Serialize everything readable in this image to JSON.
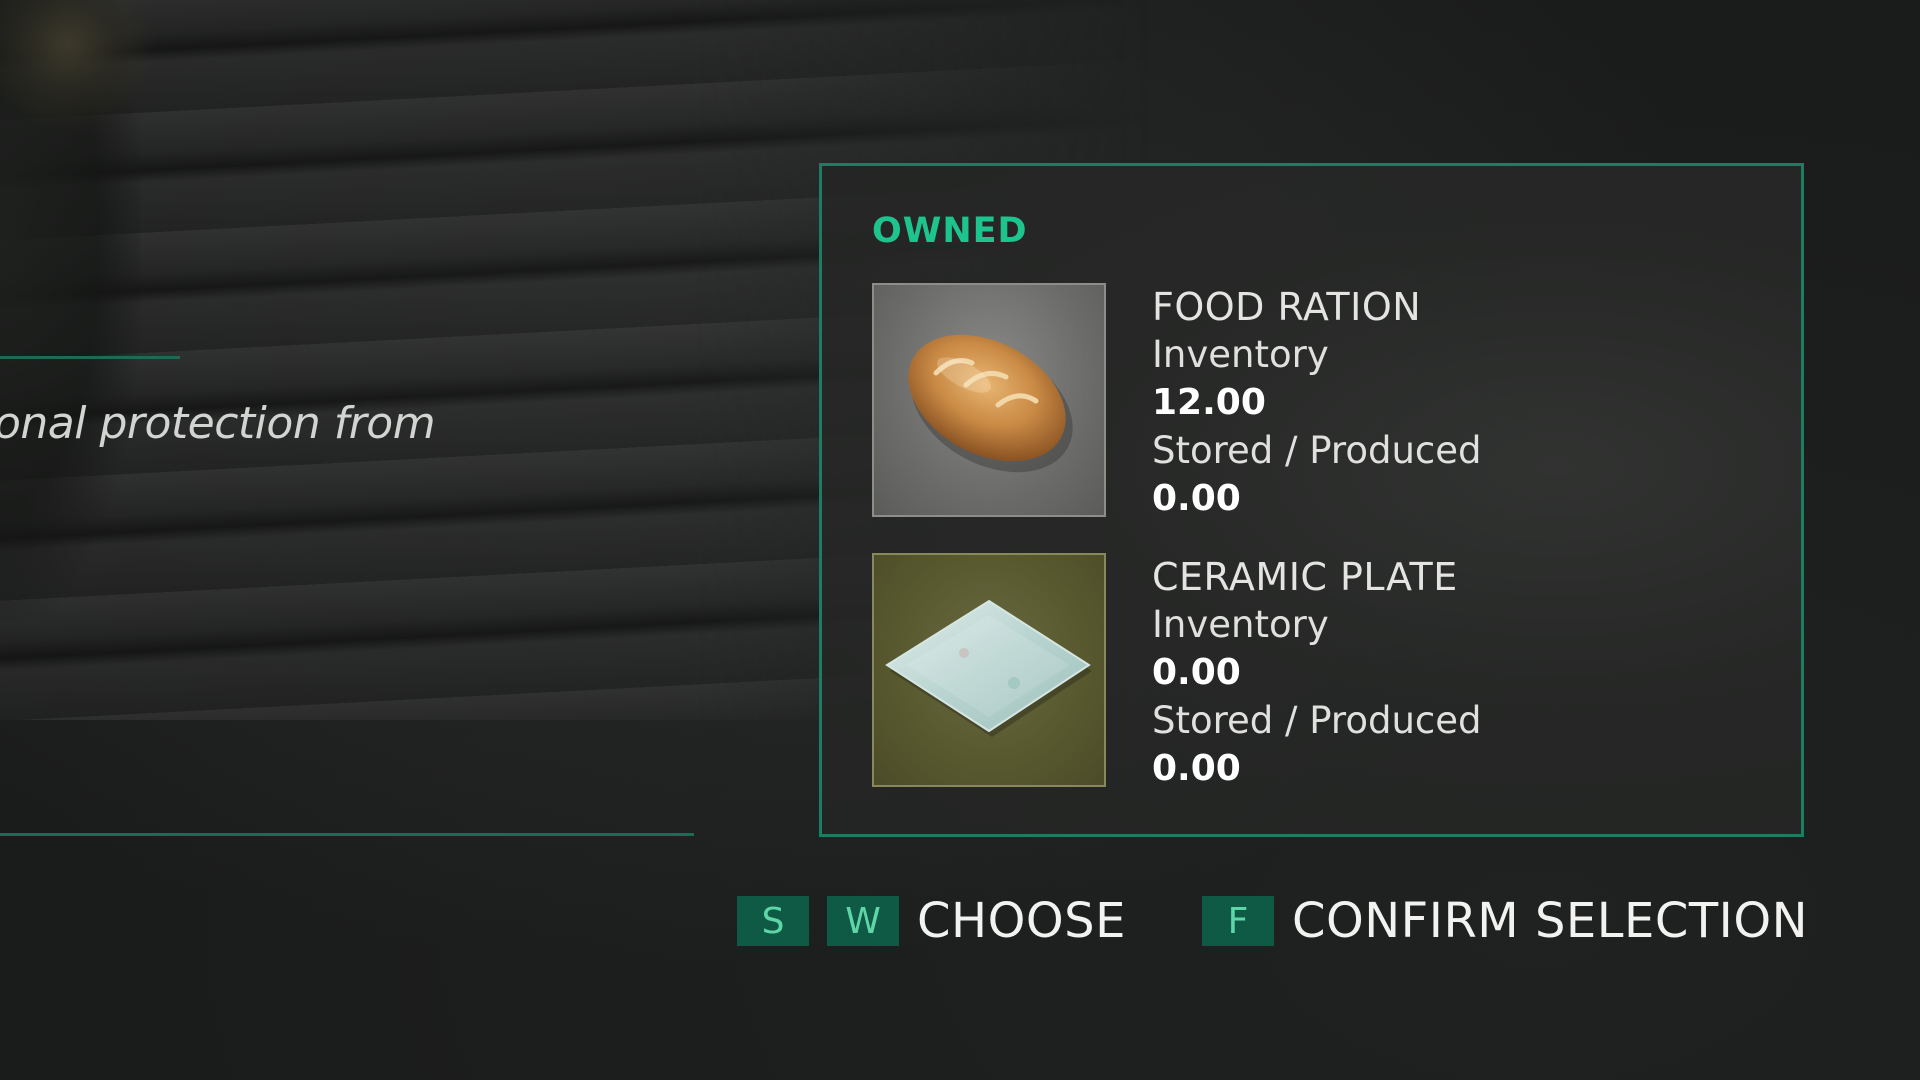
{
  "left_panel": {
    "description_fragment": "onal protection from"
  },
  "owned_panel": {
    "title": "OWNED",
    "items": [
      {
        "name": "FOOD RATION",
        "icon": "bread-icon",
        "inventory_label": "Inventory",
        "inventory_value": "12.00",
        "stored_label": "Stored / Produced",
        "stored_value": "0.00"
      },
      {
        "name": "CERAMIC PLATE",
        "icon": "ceramic-plate-icon",
        "inventory_label": "Inventory",
        "inventory_value": "0.00",
        "stored_label": "Stored / Produced",
        "stored_value": "0.00"
      }
    ]
  },
  "prompts": {
    "choose": {
      "keys": [
        "S",
        "W"
      ],
      "label": "CHOOSE"
    },
    "confirm": {
      "keys": [
        "F"
      ],
      "label": "CONFIRM SELECTION"
    }
  },
  "colors": {
    "accent": "#1ec48e",
    "panel_border": "#1c7d62",
    "key_background": "#0f5a45",
    "key_text": "#5fd6a8"
  }
}
